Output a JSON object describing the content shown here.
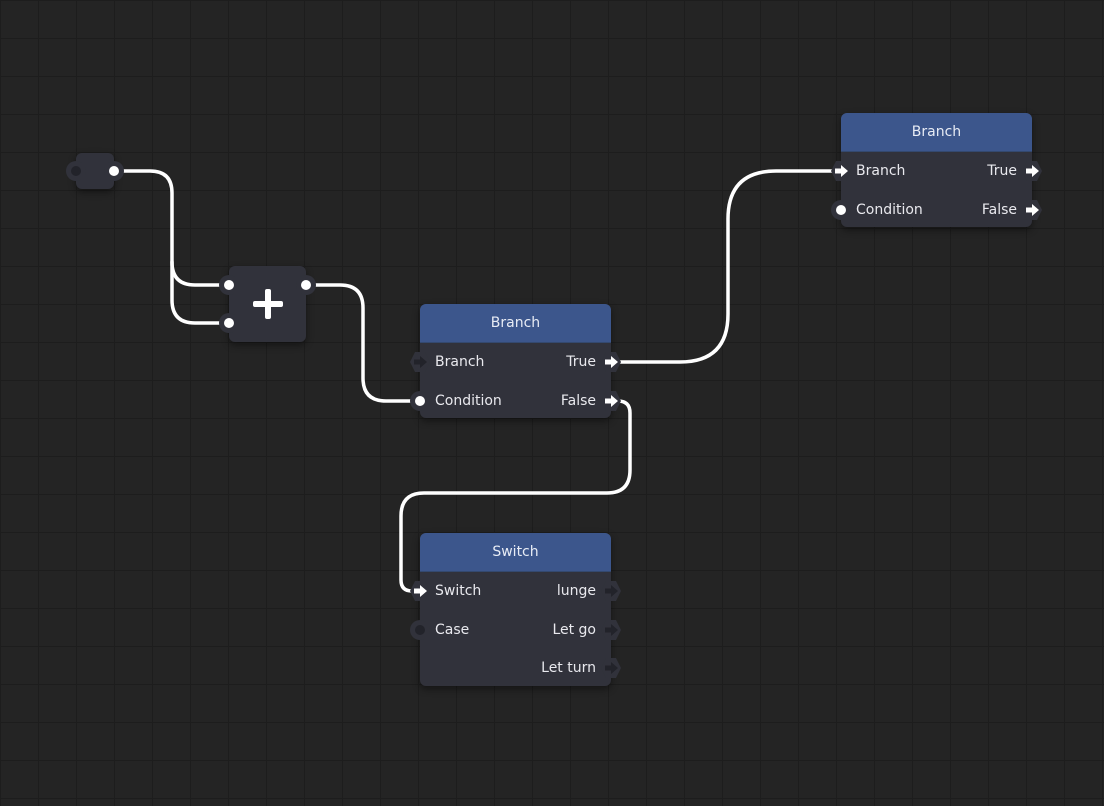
{
  "canvas": {
    "background": "#242424",
    "grid_line_color": "#1d1d1d",
    "wire_color": "#ffffff",
    "node_body_color": "#31323b",
    "node_header_color": "#3c568c"
  },
  "nodes": {
    "reroute": {
      "type": "reroute",
      "inputs": [
        {
          "kind": "data",
          "connected": false
        }
      ],
      "outputs": [
        {
          "kind": "data",
          "connected": true
        }
      ]
    },
    "add": {
      "type": "math-add",
      "icon": "plus-icon",
      "inputs": [
        {
          "kind": "data",
          "connected": true
        },
        {
          "kind": "data",
          "connected": true
        }
      ],
      "outputs": [
        {
          "kind": "data",
          "connected": true
        }
      ]
    },
    "branch1": {
      "title": "Branch",
      "inputs": [
        {
          "label": "Branch",
          "kind": "exec",
          "connected": false
        },
        {
          "label": "Condition",
          "kind": "data",
          "connected": true
        }
      ],
      "outputs": [
        {
          "label": "True",
          "kind": "exec",
          "connected": true
        },
        {
          "label": "False",
          "kind": "exec",
          "connected": true
        }
      ]
    },
    "branch2": {
      "title": "Branch",
      "inputs": [
        {
          "label": "Branch",
          "kind": "exec",
          "connected": true
        },
        {
          "label": "Condition",
          "kind": "data",
          "connected": true
        }
      ],
      "outputs": [
        {
          "label": "True",
          "kind": "exec",
          "connected": true
        },
        {
          "label": "False",
          "kind": "exec",
          "connected": true
        }
      ]
    },
    "switch": {
      "title": "Switch",
      "inputs": [
        {
          "label": "Switch",
          "kind": "exec",
          "connected": true
        },
        {
          "label": "Case",
          "kind": "data",
          "connected": false
        }
      ],
      "outputs": [
        {
          "label": "lunge",
          "kind": "exec",
          "connected": false
        },
        {
          "label": "Let go",
          "kind": "exec",
          "connected": false
        },
        {
          "label": "Let turn",
          "kind": "exec",
          "connected": false
        }
      ]
    }
  },
  "connections": [
    {
      "from": "reroute.out0",
      "to": "add.in0"
    },
    {
      "from": "reroute.out0",
      "to": "add.in1"
    },
    {
      "from": "add.out0",
      "to": "branch1.Condition"
    },
    {
      "from": "branch1.True",
      "to": "branch2.Branch"
    },
    {
      "from": "branch1.False",
      "to": "switch.Switch"
    }
  ]
}
